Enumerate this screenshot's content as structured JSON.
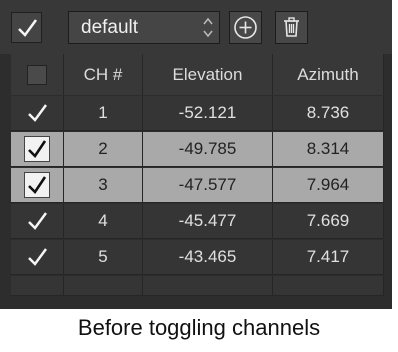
{
  "toolbar": {
    "preset_value": "default"
  },
  "table": {
    "headers": [
      "CH #",
      "Elevation",
      "Azimuth"
    ],
    "rows": [
      {
        "ch": "1",
        "elevation": "-52.121",
        "azimuth": "8.736",
        "checked": true,
        "selected": false
      },
      {
        "ch": "2",
        "elevation": "-49.785",
        "azimuth": "8.314",
        "checked": true,
        "selected": true
      },
      {
        "ch": "3",
        "elevation": "-47.577",
        "azimuth": "7.964",
        "checked": true,
        "selected": true
      },
      {
        "ch": "4",
        "elevation": "-45.477",
        "azimuth": "7.669",
        "checked": true,
        "selected": false
      },
      {
        "ch": "5",
        "elevation": "-43.465",
        "azimuth": "7.417",
        "checked": true,
        "selected": false
      }
    ]
  },
  "caption": "Before toggling channels",
  "colors": {
    "panel_bg": "#2d2d2d",
    "selected_row_bg": "#a9a9a9"
  }
}
